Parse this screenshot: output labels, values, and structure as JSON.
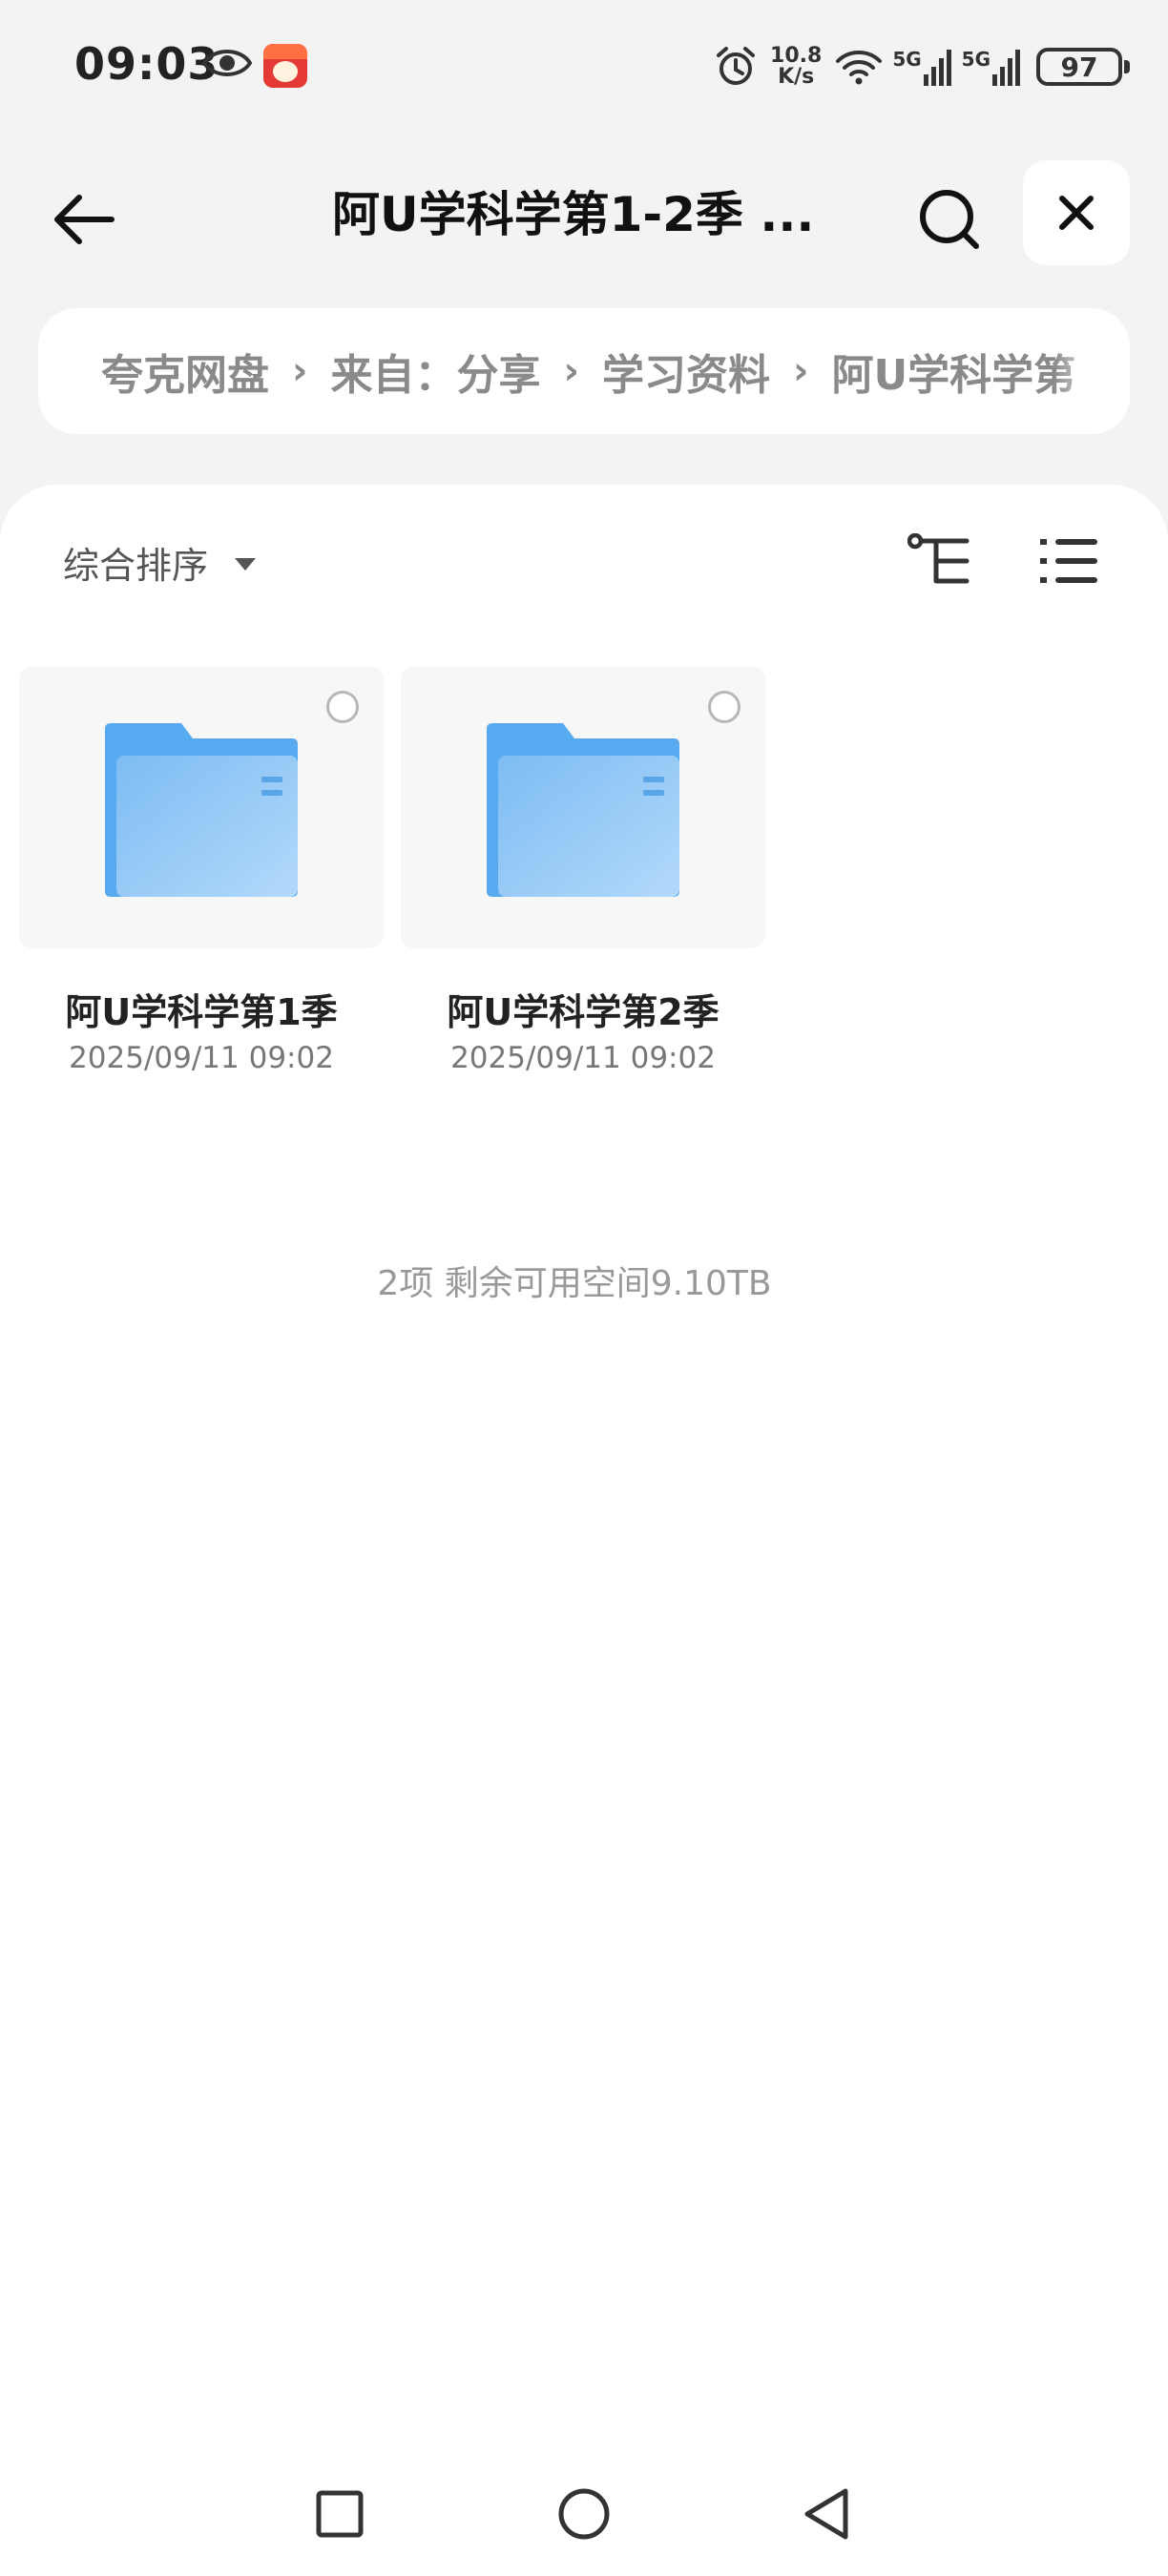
{
  "status_bar": {
    "time": "09:03",
    "net_speed_value": "10.8",
    "net_speed_unit": "K/s",
    "signal1_label": "5G",
    "signal2_label": "5G",
    "battery": "97"
  },
  "nav": {
    "title": "阿U学科学第1-2季 ...",
    "icons": {
      "back": "arrow-left-icon",
      "search": "search-icon",
      "close": "close-icon"
    }
  },
  "breadcrumb": {
    "items": [
      "夸克网盘",
      "来自：分享",
      "学习资料",
      "阿U学科学第"
    ]
  },
  "toolbar": {
    "sort_label": "综合排序",
    "icons": {
      "tree_view": "tree-view-icon",
      "list_view": "list-view-icon"
    }
  },
  "files": [
    {
      "name": "阿U学科学第1季",
      "date": "2025/09/11 09:02"
    },
    {
      "name": "阿U学科学第2季",
      "date": "2025/09/11 09:02"
    }
  ],
  "summary": "2项 剩余可用空间9.10TB",
  "colors": {
    "folder": "#5aaef0",
    "folder_front": "#8fc6f5",
    "accent": "#111111"
  }
}
